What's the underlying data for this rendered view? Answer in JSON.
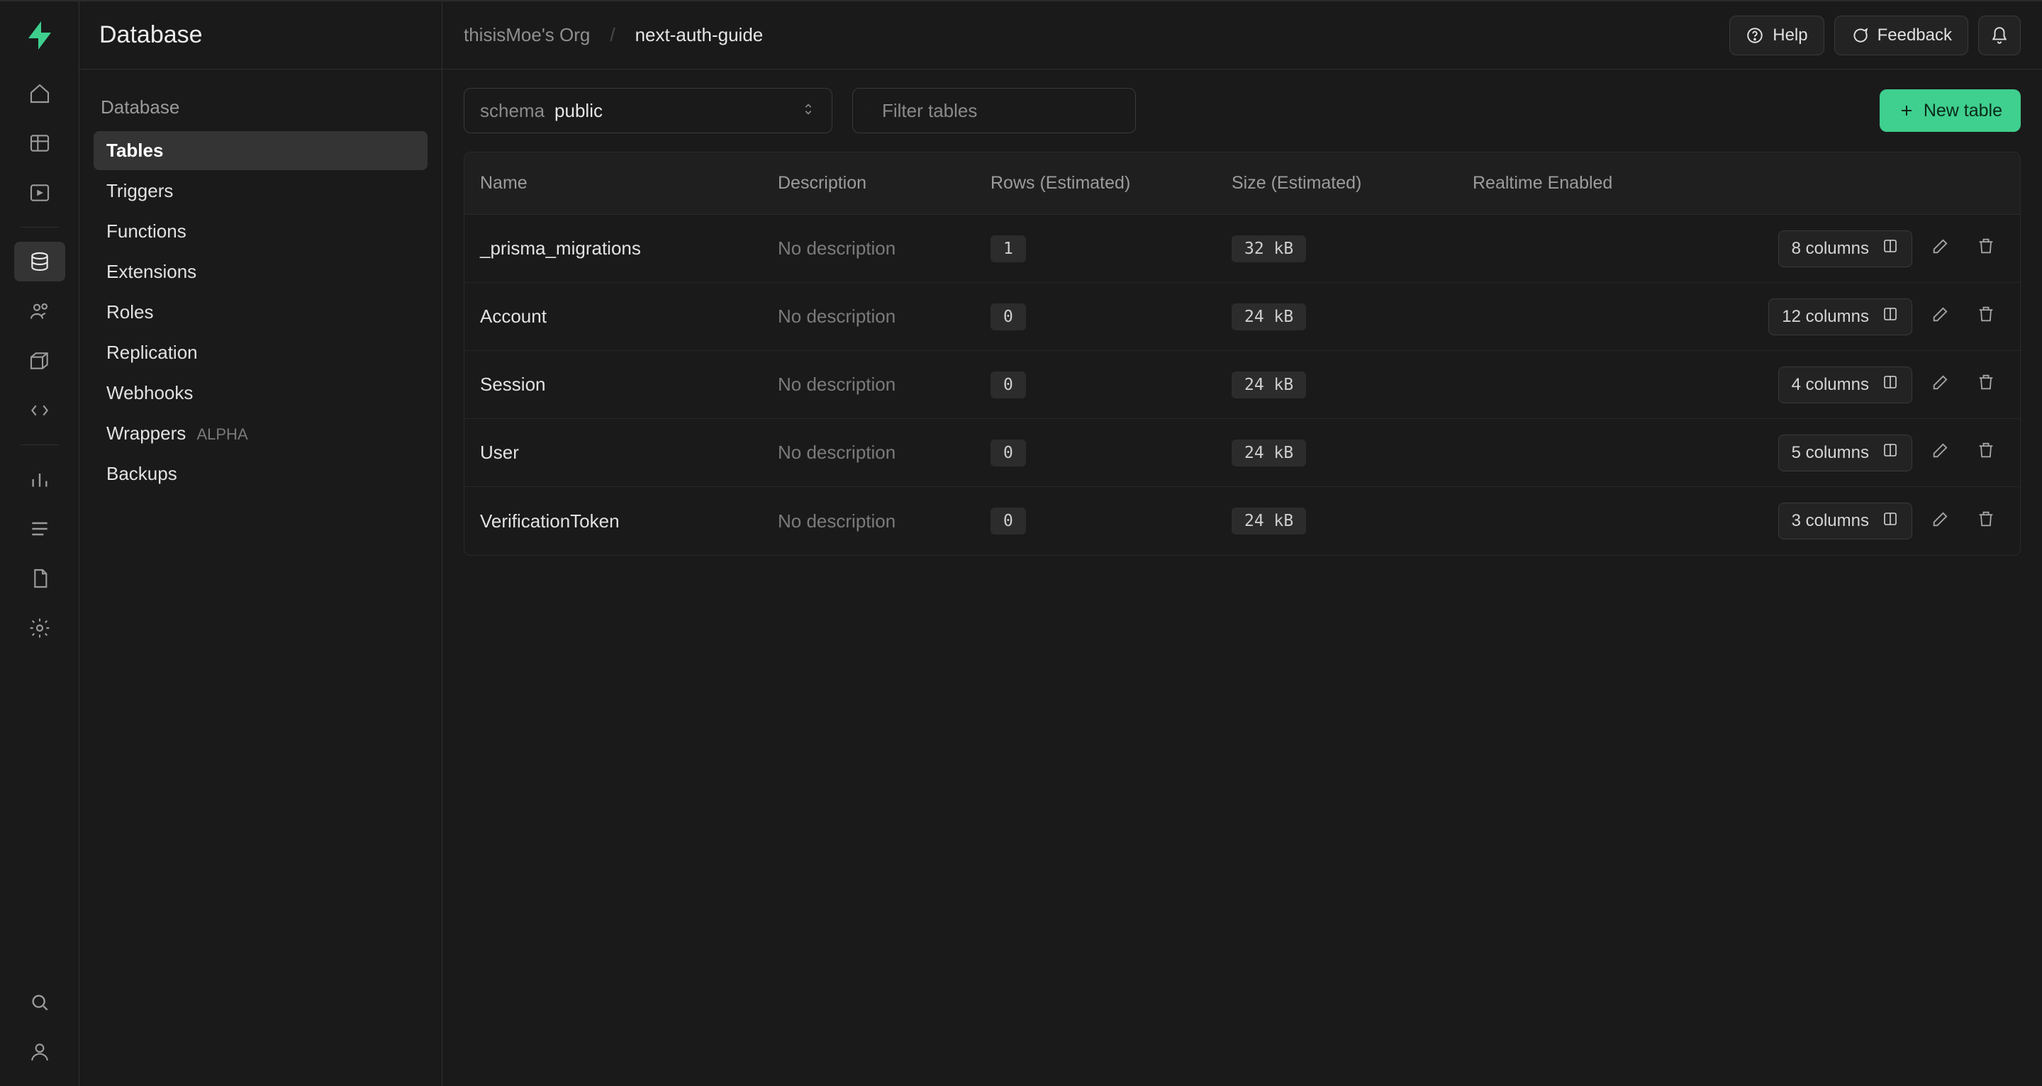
{
  "page_title": "Database",
  "breadcrumb": {
    "org": "thisisMoe's Org",
    "project": "next-auth-guide"
  },
  "topbar": {
    "help_label": "Help",
    "feedback_label": "Feedback"
  },
  "sidebar": {
    "heading": "Database",
    "items": [
      {
        "label": "Tables",
        "active": true
      },
      {
        "label": "Triggers"
      },
      {
        "label": "Functions"
      },
      {
        "label": "Extensions"
      },
      {
        "label": "Roles"
      },
      {
        "label": "Replication"
      },
      {
        "label": "Webhooks"
      },
      {
        "label": "Wrappers",
        "alpha": "ALPHA"
      },
      {
        "label": "Backups"
      }
    ]
  },
  "toolbar": {
    "schema_label": "schema",
    "schema_value": "public",
    "filter_placeholder": "Filter tables",
    "new_table_label": "New table"
  },
  "table": {
    "headers": {
      "name": "Name",
      "description": "Description",
      "rows": "Rows (Estimated)",
      "size": "Size (Estimated)",
      "realtime": "Realtime Enabled"
    },
    "rows": [
      {
        "name": "_prisma_migrations",
        "description": "No description",
        "rows": "1",
        "size": "32 kB",
        "columns": "8 columns"
      },
      {
        "name": "Account",
        "description": "No description",
        "rows": "0",
        "size": "24 kB",
        "columns": "12 columns"
      },
      {
        "name": "Session",
        "description": "No description",
        "rows": "0",
        "size": "24 kB",
        "columns": "4 columns"
      },
      {
        "name": "User",
        "description": "No description",
        "rows": "0",
        "size": "24 kB",
        "columns": "5 columns"
      },
      {
        "name": "VerificationToken",
        "description": "No description",
        "rows": "0",
        "size": "24 kB",
        "columns": "3 columns"
      }
    ]
  }
}
